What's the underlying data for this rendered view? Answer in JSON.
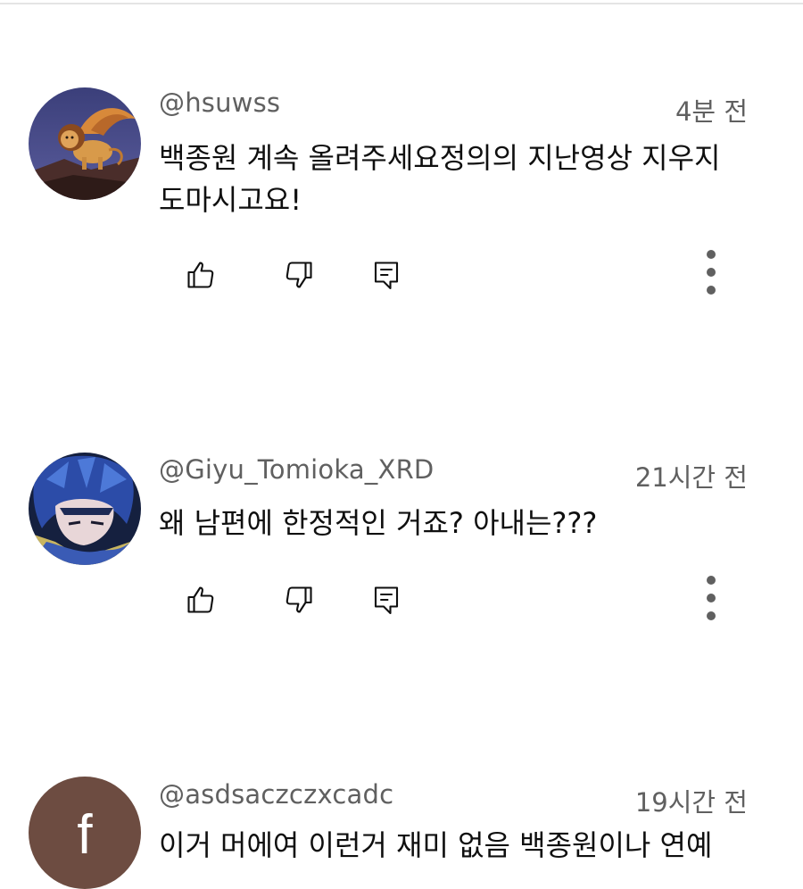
{
  "comments": [
    {
      "author": "@hsuwss",
      "time": "4분 전",
      "text_line1": "백종원 계속 올려주세요정의의 지난영상 지우지",
      "text_line2": "도마시고요!",
      "avatar": "winged-lion-illustration"
    },
    {
      "author": "@Giyu_Tomioka_XRD",
      "time": "21시간 전",
      "text_line1": "왜 남편에 한정적인 거죠? 아내는???",
      "avatar": "anime-character-blue-hair"
    },
    {
      "author": "@asdsaczczxcadc",
      "time": "19시간 전",
      "text_line1": "이거 머에여 이런거 재미 없음 백종원이나 연예",
      "avatar_letter": "f",
      "avatar_color": "#6d4c41"
    }
  ],
  "icons": {
    "like": "thumbs-up-icon",
    "dislike": "thumbs-down-icon",
    "reply": "reply-icon",
    "more": "more-vert-icon"
  }
}
